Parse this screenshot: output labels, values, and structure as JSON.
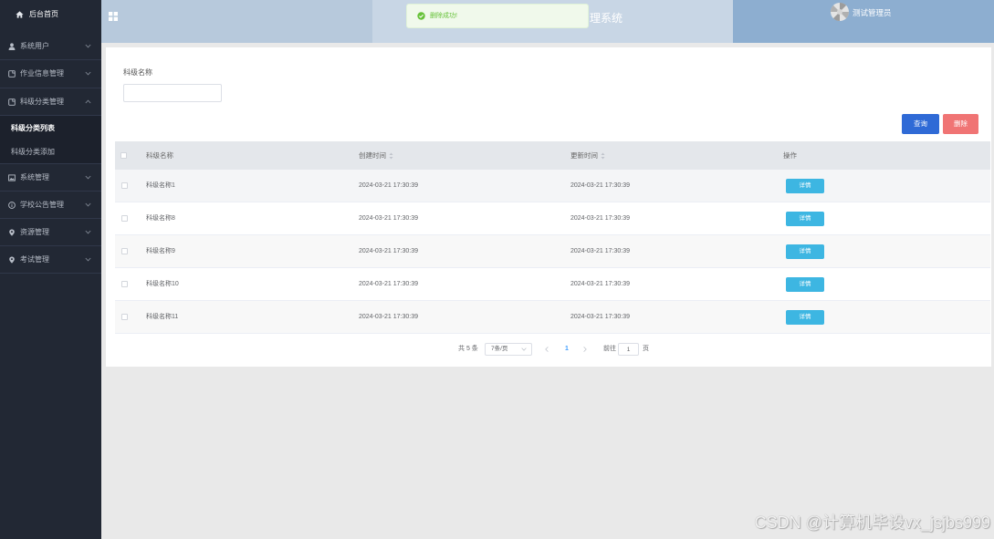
{
  "sidebar": {
    "home": {
      "label": "后台首页",
      "icon": "home-icon"
    },
    "items": [
      {
        "label": "系统用户",
        "icon": "user-icon",
        "chevron": "chevron-down-icon"
      },
      {
        "label": "作业信息管理",
        "icon": "document-icon",
        "chevron": "chevron-down-icon"
      },
      {
        "label": "科级分类管理",
        "icon": "document-icon",
        "chevron": "chevron-up-icon",
        "expanded": true,
        "children": [
          {
            "label": "科级分类列表",
            "active": true
          },
          {
            "label": "科级分类添加",
            "active": false
          }
        ]
      },
      {
        "label": "系统管理",
        "icon": "image-icon",
        "chevron": "chevron-down-icon"
      },
      {
        "label": "学校公告管理",
        "icon": "info-icon",
        "chevron": "chevron-down-icon"
      },
      {
        "label": "资源管理",
        "icon": "location-icon",
        "chevron": "chevron-down-icon"
      },
      {
        "label": "考试管理",
        "icon": "location-icon",
        "chevron": "chevron-down-icon"
      }
    ]
  },
  "header": {
    "menu_icon": "grid-icon",
    "title": "理系统",
    "avatar_icon": "avatar-icon",
    "user_name": "测试管理员"
  },
  "toast": {
    "type": "success",
    "icon": "check-circle-icon",
    "message": "删除成功!"
  },
  "search": {
    "field_label": "科级名称",
    "value": ""
  },
  "actions": {
    "query_label": "查询",
    "delete_label": "删除"
  },
  "table": {
    "columns": [
      {
        "label": "科级名称",
        "sortable": false
      },
      {
        "label": "创建时间",
        "sortable": true
      },
      {
        "label": "更新时间",
        "sortable": true
      },
      {
        "label": "操作",
        "sortable": false
      }
    ],
    "row_action_label": "详情",
    "rows": [
      {
        "checked": false,
        "name": "科级名称1",
        "created": "2024-03-21 17:30:39",
        "updated": "2024-03-21 17:30:39"
      },
      {
        "checked": false,
        "name": "科级名称8",
        "created": "2024-03-21 17:30:39",
        "updated": "2024-03-21 17:30:39"
      },
      {
        "checked": false,
        "name": "科级名称9",
        "created": "2024-03-21 17:30:39",
        "updated": "2024-03-21 17:30:39"
      },
      {
        "checked": false,
        "name": "科级名称10",
        "created": "2024-03-21 17:30:39",
        "updated": "2024-03-21 17:30:39"
      },
      {
        "checked": false,
        "name": "科级名称11",
        "created": "2024-03-21 17:30:39",
        "updated": "2024-03-21 17:30:39"
      }
    ]
  },
  "pagination": {
    "total_text": "共 5 条",
    "page_size": "7条/页",
    "current_page": "1",
    "goto_label": "前往",
    "goto_value": "1",
    "page_suffix": "页"
  },
  "watermark": "CSDN @计算机毕设vx_jsjbs999",
  "colors": {
    "sidebar_bg": "#222834",
    "header_left": "#b7c9dc",
    "header_mid": "#c8d6e5",
    "header_right": "#8daed0",
    "primary": "#2f6ad6",
    "danger": "#f07474",
    "info": "#3db6e2",
    "success": "#67c23a",
    "page_bg": "#e9e9e9",
    "page_active": "#409eff"
  }
}
